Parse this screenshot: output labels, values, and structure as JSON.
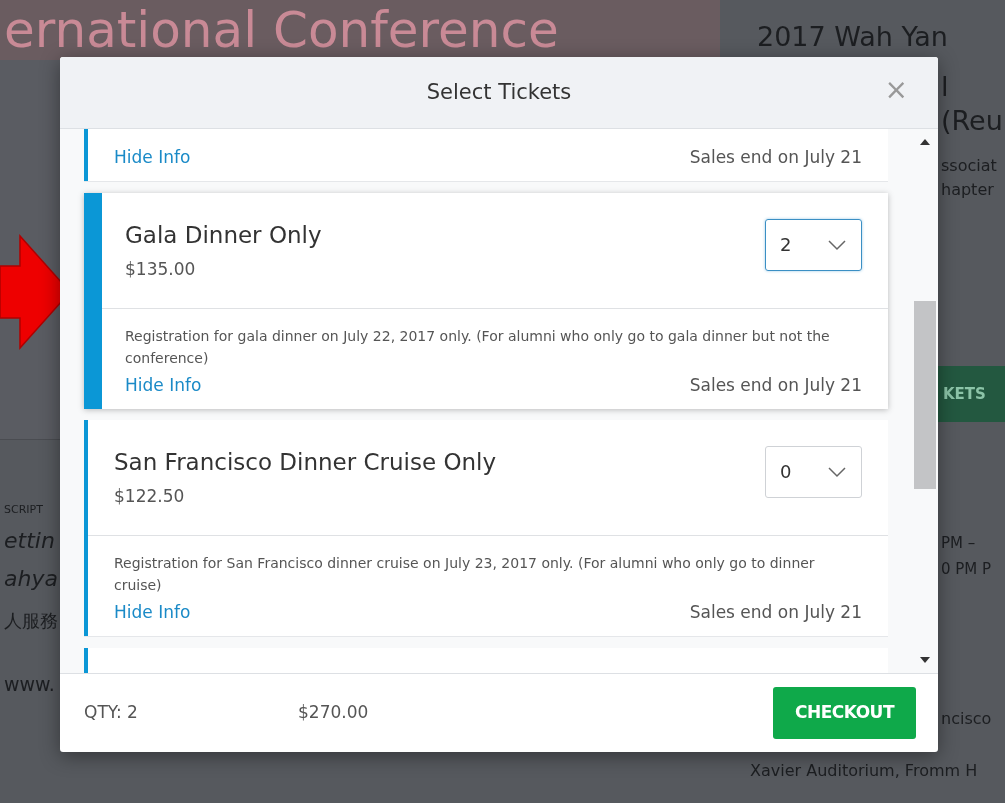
{
  "background_page": {
    "banner_title": "ernational Conference",
    "event_title_lines": [
      "2017 Wah Yan",
      "l",
      "(Reu"
    ],
    "organizer_lines": [
      "ssociat",
      "hapter"
    ],
    "tickets_button": "KETS",
    "section_label": "SCRIPT",
    "description_lines": [
      "ettin",
      "ahya"
    ],
    "chinese_text": "人服務",
    "website": "www.",
    "time_lines": [
      "PM –",
      "0 PM P"
    ],
    "venue_lines": [
      "ncisco",
      "Xavier Auditorium, Fromm H"
    ]
  },
  "modal": {
    "title": "Select Tickets",
    "close": "×",
    "tickets": [
      {
        "link": "Hide Info",
        "sales_end": "Sales end on July 21",
        "selected": false
      },
      {
        "name": "Gala Dinner Only",
        "price": "$135.00",
        "quantity": "2",
        "description": "Registration for gala dinner on July 22, 2017 only. (For alumni who only go to gala dinner but not the conference)",
        "link": "Hide Info",
        "sales_end": "Sales end on July 21",
        "selected": true
      },
      {
        "name": "San Francisco Dinner Cruise Only",
        "price": "$122.50",
        "quantity": "0",
        "description": "Registration for San Francisco dinner cruise on July 23, 2017 only. (For alumni who only go to dinner cruise)",
        "link": "Hide Info",
        "sales_end": "Sales end on July 21",
        "selected": false
      }
    ],
    "footer": {
      "qty": "QTY: 2",
      "total": "$270.00",
      "checkout": "CHECKOUT"
    }
  }
}
